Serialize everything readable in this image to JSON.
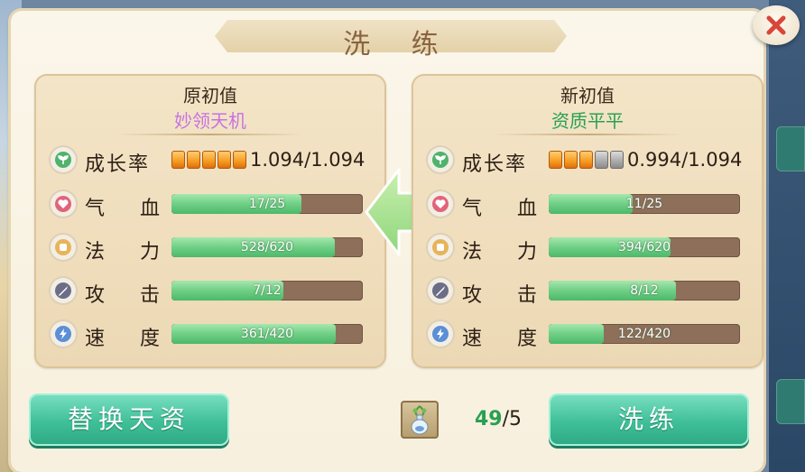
{
  "dialog": {
    "title": "洗 练",
    "close_icon": "close-x-icon"
  },
  "left_panel": {
    "heading": "原初值",
    "quality": "妙领天机",
    "growth": {
      "label": "成长率",
      "pips_on": 5,
      "pips_total": 5,
      "value": "1.094/1.094"
    },
    "stats": [
      {
        "label": "气 血",
        "icon": "heart-icon",
        "value": "17/25",
        "current": 17,
        "max": 25
      },
      {
        "label": "法 力",
        "icon": "mana-icon",
        "value": "528/620",
        "current": 528,
        "max": 620
      },
      {
        "label": "攻 击",
        "icon": "sword-icon",
        "value": "7/12",
        "current": 7,
        "max": 12
      },
      {
        "label": "速 度",
        "icon": "lightning-icon",
        "value": "361/420",
        "current": 361,
        "max": 420
      }
    ]
  },
  "right_panel": {
    "heading": "新初值",
    "quality": "资质平平",
    "growth": {
      "label": "成长率",
      "pips_on": 3,
      "pips_total": 5,
      "value": "0.994/1.094"
    },
    "stats": [
      {
        "label": "气 血",
        "icon": "heart-icon",
        "value": "11/25",
        "current": 11,
        "max": 25
      },
      {
        "label": "法 力",
        "icon": "mana-icon",
        "value": "394/620",
        "current": 394,
        "max": 620
      },
      {
        "label": "攻 击",
        "icon": "sword-icon",
        "value": "8/12",
        "current": 8,
        "max": 12
      },
      {
        "label": "速 度",
        "icon": "lightning-icon",
        "value": "122/420",
        "current": 122,
        "max": 420
      }
    ]
  },
  "actions": {
    "replace_label": "替换天资",
    "refine_label": "洗练",
    "item_count_current": "49",
    "item_count_sep_max": "/5"
  },
  "colors": {
    "quality_rare": "#c773e0",
    "quality_common": "#2aa052",
    "bar_fill": "#6fcf85",
    "bar_track": "#8e6f5a",
    "button": "#3fbf98"
  }
}
